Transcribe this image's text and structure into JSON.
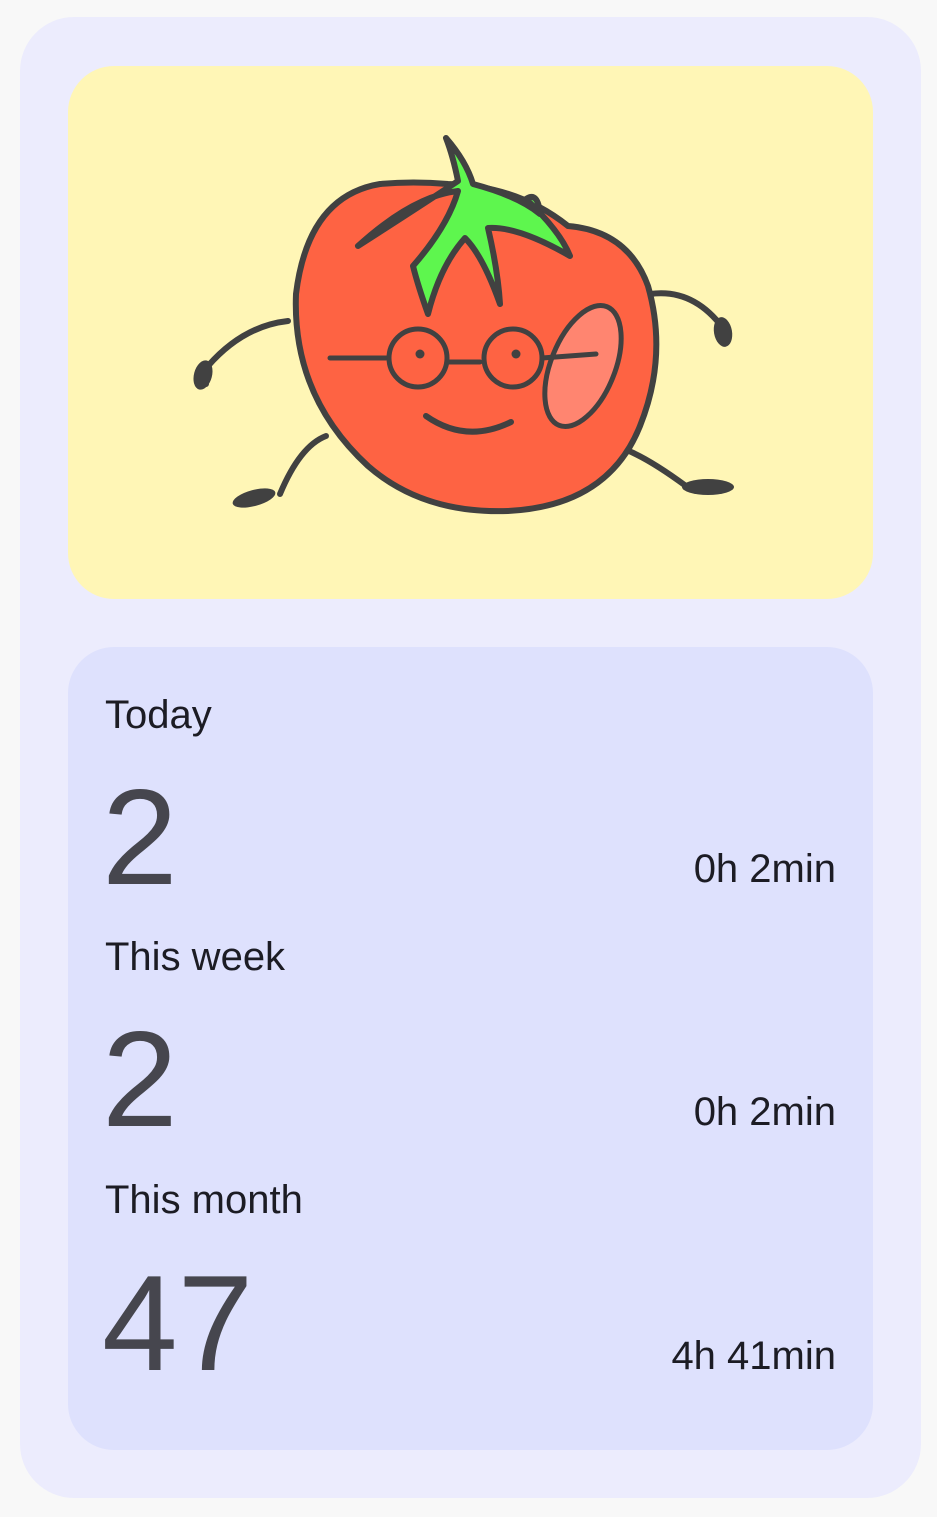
{
  "mascot": {
    "icon": "tomato-mascot-with-glasses",
    "background_color": "#fff6b6"
  },
  "stats": [
    {
      "label": "Today",
      "count": "2",
      "duration": "0h 2min"
    },
    {
      "label": "This week",
      "count": "2",
      "duration": "0h 2min"
    },
    {
      "label": "This month",
      "count": "47",
      "duration": "4h 41min"
    }
  ]
}
